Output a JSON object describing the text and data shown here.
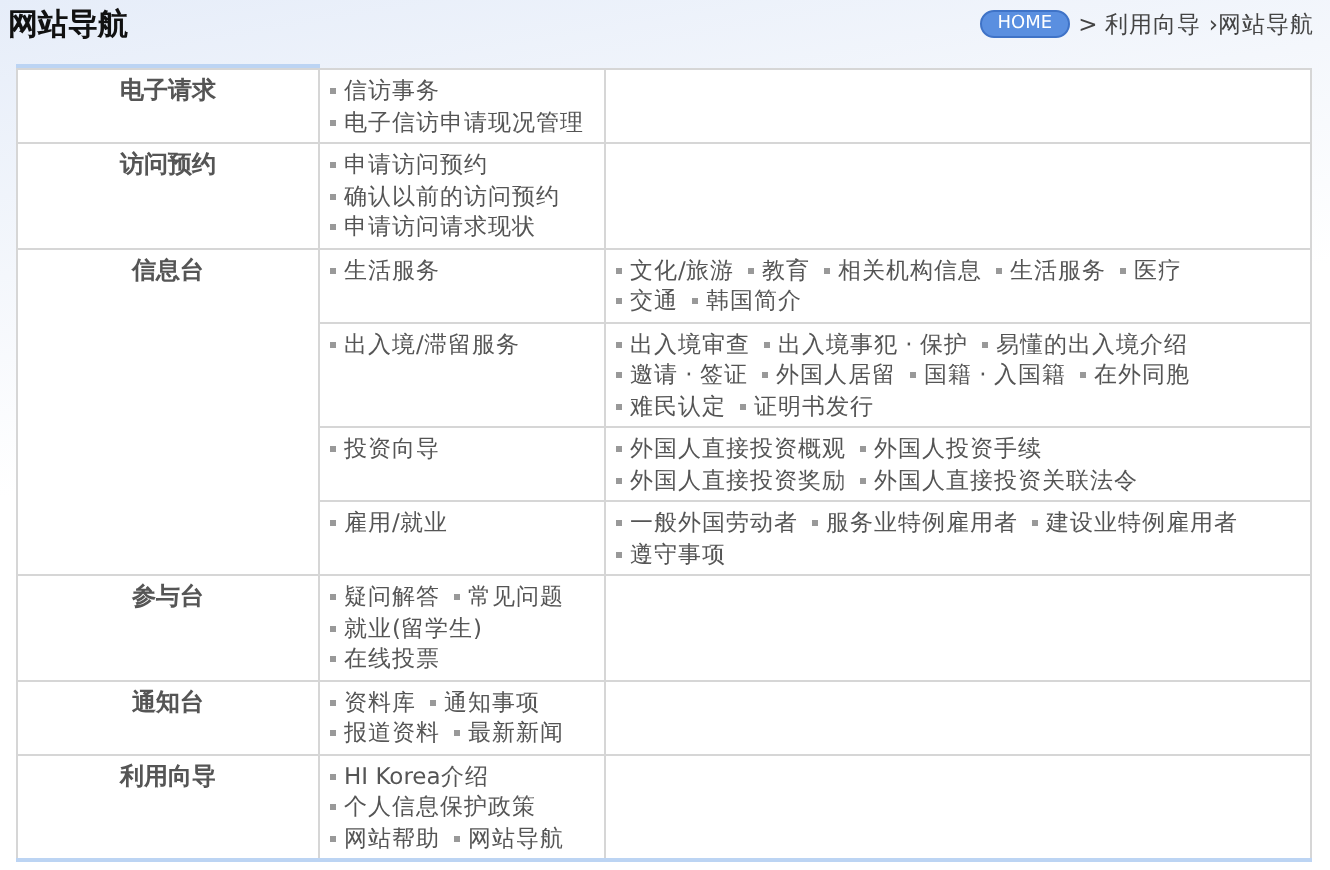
{
  "header": {
    "title": "网站导航",
    "breadcrumb": {
      "home": "HOME",
      "items": [
        "> 利用向导",
        "›网站导航"
      ]
    }
  },
  "sections": [
    {
      "name": "电子请求",
      "rows": [
        {
          "sub": [
            [
              "信访事务"
            ],
            [
              "电子信访申请现况管理"
            ]
          ],
          "links": []
        }
      ]
    },
    {
      "name": "访问预约",
      "rows": [
        {
          "sub": [
            [
              "申请访问预约"
            ],
            [
              "确认以前的访问预约"
            ],
            [
              "申请访问请求现状"
            ]
          ],
          "links": []
        }
      ]
    },
    {
      "name": "信息台",
      "rows": [
        {
          "sub": [
            [
              "生活服务"
            ]
          ],
          "links": [
            [
              "文化/旅游",
              "教育",
              "相关机构信息",
              "生活服务",
              "医疗"
            ],
            [
              "交通",
              "韩国简介"
            ]
          ]
        },
        {
          "sub": [
            [
              "出入境/滞留服务"
            ]
          ],
          "links": [
            [
              "出入境审查",
              "出入境事犯 · 保护",
              "易懂的出入境介绍"
            ],
            [
              "邀请 · 签证",
              "外国人居留",
              "国籍 · 入国籍",
              "在外同胞"
            ],
            [
              "难民认定",
              "证明书发行"
            ]
          ]
        },
        {
          "sub": [
            [
              "投资向导"
            ]
          ],
          "links": [
            [
              "外国人直接投资概观",
              "外国人投资手续"
            ],
            [
              "外国人直接投资奖励",
              "外国人直接投资关联法令"
            ]
          ]
        },
        {
          "sub": [
            [
              "雇用/就业"
            ]
          ],
          "links": [
            [
              "一般外国劳动者",
              "服务业特例雇用者",
              "建设业特例雇用者"
            ],
            [
              "遵守事项"
            ]
          ]
        }
      ]
    },
    {
      "name": "参与台",
      "rows": [
        {
          "sub": [
            [
              "疑问解答",
              "常见问题"
            ],
            [
              "就业(留学生)"
            ],
            [
              "在线投票"
            ]
          ],
          "links": []
        }
      ]
    },
    {
      "name": "通知台",
      "rows": [
        {
          "sub": [
            [
              "资料库",
              "通知事项"
            ],
            [
              "报道资料",
              "最新新闻"
            ]
          ],
          "links": []
        }
      ]
    },
    {
      "name": "利用向导",
      "rows": [
        {
          "sub": [
            [
              "HI Korea介绍"
            ],
            [
              "个人信息保护政策"
            ],
            [
              "网站帮助",
              "网站导航"
            ]
          ],
          "links": []
        }
      ]
    }
  ]
}
